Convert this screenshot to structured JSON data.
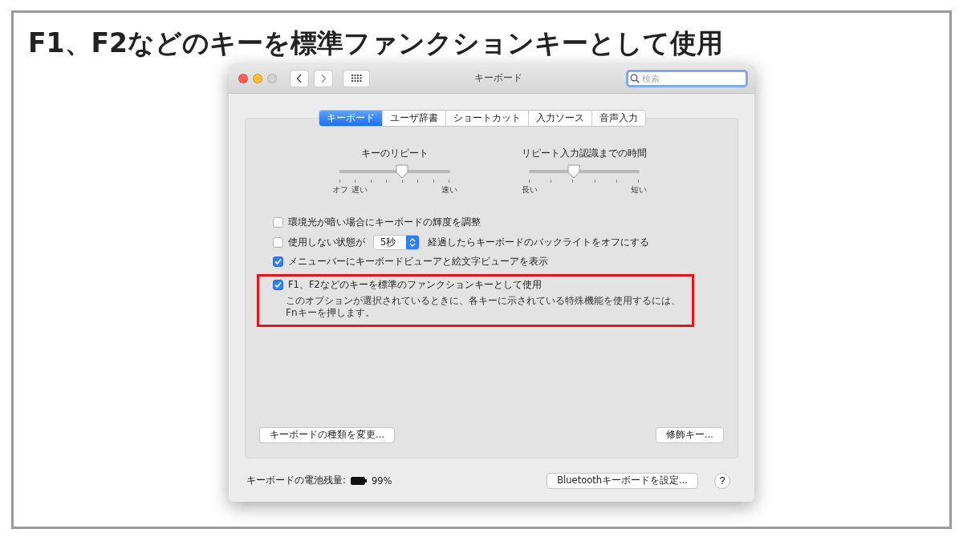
{
  "heading": "F1、F2などのキーを標準ファンクションキーとして使用",
  "window": {
    "title": "キーボード",
    "search": {
      "placeholder": "検索"
    }
  },
  "tabs": [
    {
      "label": "キーボード",
      "selected": true
    },
    {
      "label": "ユーザ辞書",
      "selected": false
    },
    {
      "label": "ショートカット",
      "selected": false
    },
    {
      "label": "入力ソース",
      "selected": false
    },
    {
      "label": "音声入力",
      "selected": false
    }
  ],
  "sliders": [
    {
      "label": "キーのリピート",
      "level": 0.57,
      "tick_labels": [
        "オフ",
        "遅い",
        "速い"
      ]
    },
    {
      "label": "リピート入力認識までの時間",
      "level": 0.41,
      "tick_labels": [
        "長い",
        "短い"
      ]
    }
  ],
  "options": [
    {
      "kind": "plain",
      "label": "環境光が暗い場合にキーボードの輝度を調整",
      "checked": false,
      "highlighted": false
    },
    {
      "kind": "select",
      "label": "使用しない状態が",
      "value": "5秒",
      "suffix": "経過したらキーボードのバックライトをオフにする",
      "checked": false,
      "highlighted": false
    },
    {
      "kind": "plain",
      "label": "メニューバーにキーボードビューアと絵文字ビューアを表示",
      "checked": true,
      "highlighted": false
    },
    {
      "kind": "described",
      "label": "F1、F2などのキーを標準のファンクションキーとして使用",
      "description": "このオプションが選択されているときに、各キーに示されている特殊機能を使用するには、Fnキーを押します。",
      "checked": true,
      "highlighted": true
    }
  ],
  "panel_buttons": [
    "キーボードの種類を変更...",
    "修飾キー..."
  ],
  "footer": {
    "battery_label": "キーボードの電池残量:",
    "battery_reading": "99%",
    "button": "Bluetoothキーボードを設定...",
    "help": "?"
  }
}
